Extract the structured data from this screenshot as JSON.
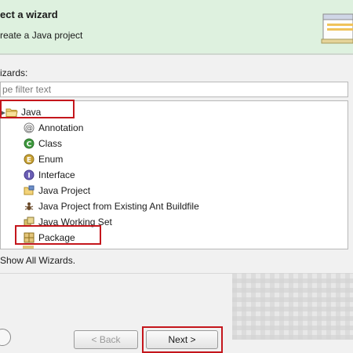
{
  "header": {
    "title": "ect a wizard",
    "subtitle": "reate a Java project"
  },
  "wizards_label": "izards:",
  "filter": {
    "placeholder": "pe filter text",
    "value": ""
  },
  "tree": {
    "root": {
      "label": "Java",
      "expanded": true
    },
    "items": [
      {
        "label": "Annotation",
        "icon": "annotation-icon"
      },
      {
        "label": "Class",
        "icon": "class-icon"
      },
      {
        "label": "Enum",
        "icon": "enum-icon"
      },
      {
        "label": "Interface",
        "icon": "interface-icon"
      },
      {
        "label": "Java Project",
        "icon": "java-project-icon"
      },
      {
        "label": "Java Project from Existing Ant Buildfile",
        "icon": "ant-buildfile-icon"
      },
      {
        "label": "Java Working Set",
        "icon": "working-set-icon"
      },
      {
        "label": "Package",
        "icon": "package-icon"
      }
    ]
  },
  "show_all": {
    "label": "Show All Wizards.",
    "checked": false
  },
  "buttons": {
    "back": "< Back",
    "next": "Next >",
    "help": "?"
  },
  "colors": {
    "banner": "#def1df",
    "highlight": "#c4161c"
  }
}
